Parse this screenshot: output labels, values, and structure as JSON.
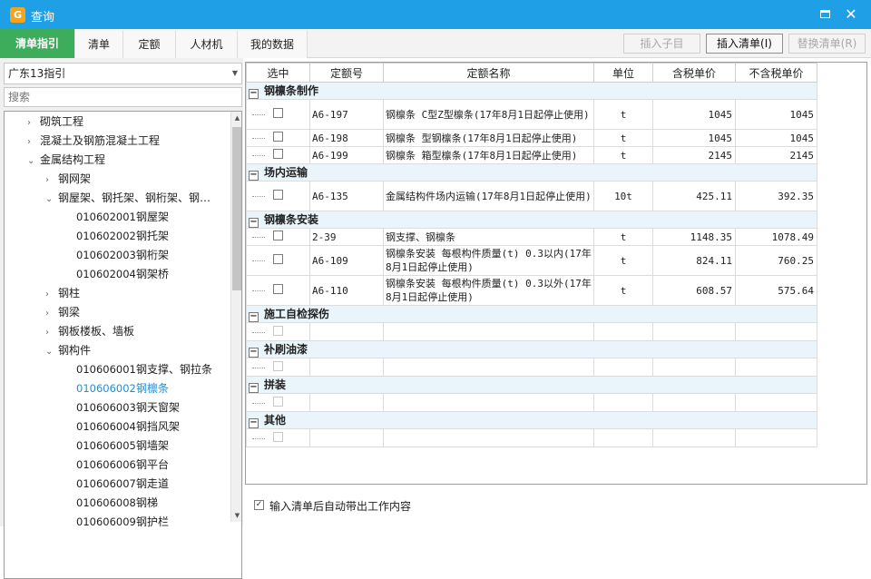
{
  "window": {
    "title": "查询",
    "app_icon": "app-logo-icon",
    "maximize_icon": "maximize-icon",
    "close_icon": "close-icon",
    "close_glyph": "✕"
  },
  "tabs": [
    {
      "label": "清单指引",
      "active": true
    },
    {
      "label": "清单",
      "active": false
    },
    {
      "label": "定额",
      "active": false
    },
    {
      "label": "人材机",
      "active": false
    },
    {
      "label": "我的数据",
      "active": false
    }
  ],
  "toolbar": {
    "insert_child": "插入子目",
    "insert_list": "插入清单(I)",
    "replace_list": "替换清单(R)"
  },
  "left": {
    "region": "广东13指引",
    "search_placeholder": "搜索",
    "tree": [
      {
        "label": "砌筑工程",
        "level": 1,
        "expander": "›"
      },
      {
        "label": "混凝土及钢筋混凝土工程",
        "level": 1,
        "expander": "›"
      },
      {
        "label": "金属结构工程",
        "level": 1,
        "expander": "⌄"
      },
      {
        "label": "钢网架",
        "level": 2,
        "expander": "›"
      },
      {
        "label": "钢屋架、钢托架、钢桁架、钢…",
        "level": 2,
        "expander": "⌄"
      },
      {
        "code": "010602001",
        "label": "钢屋架",
        "level": 3
      },
      {
        "code": "010602002",
        "label": "钢托架",
        "level": 3
      },
      {
        "code": "010602003",
        "label": "钢桁架",
        "level": 3
      },
      {
        "code": "010602004",
        "label": "钢架桥",
        "level": 3
      },
      {
        "label": "钢柱",
        "level": 2,
        "expander": "›"
      },
      {
        "label": "钢梁",
        "level": 2,
        "expander": "›"
      },
      {
        "label": "钢板楼板、墙板",
        "level": 2,
        "expander": "›"
      },
      {
        "label": "钢构件",
        "level": 2,
        "expander": "⌄"
      },
      {
        "code": "010606001",
        "label": "钢支撑、钢拉条",
        "level": 3
      },
      {
        "code": "010606002",
        "label": "钢檩条",
        "level": 3,
        "selected": true
      },
      {
        "code": "010606003",
        "label": "钢天窗架",
        "level": 3
      },
      {
        "code": "010606004",
        "label": "钢挡风架",
        "level": 3
      },
      {
        "code": "010606005",
        "label": "钢墙架",
        "level": 3
      },
      {
        "code": "010606006",
        "label": "钢平台",
        "level": 3
      },
      {
        "code": "010606007",
        "label": "钢走道",
        "level": 3
      },
      {
        "code": "010606008",
        "label": "钢梯",
        "level": 3
      },
      {
        "code": "010606009",
        "label": "钢护栏",
        "level": 3
      }
    ]
  },
  "table": {
    "headers": [
      "选中",
      "定额号",
      "定额名称",
      "单位",
      "含税单价",
      "不含税单价"
    ],
    "groups": [
      {
        "title": "钢檩条制作",
        "rows": [
          {
            "code": "A6-197",
            "name": "钢檩条 C型Z型檩条(17年8月1日起停止使用)",
            "unit": "t",
            "tax": "1045",
            "notax": "1045"
          },
          {
            "code": "A6-198",
            "name": "钢檩条 型钢檩条(17年8月1日起停止使用)",
            "unit": "t",
            "tax": "1045",
            "notax": "1045"
          },
          {
            "code": "A6-199",
            "name": "钢檩条 箱型檩条(17年8月1日起停止使用)",
            "unit": "t",
            "tax": "2145",
            "notax": "2145"
          }
        ]
      },
      {
        "title": "场内运输",
        "rows": [
          {
            "code": "A6-135",
            "name": "金属结构件场内运输(17年8月1日起停止使用)",
            "unit": "10t",
            "tax": "425.11",
            "notax": "392.35"
          }
        ]
      },
      {
        "title": "钢檩条安装",
        "rows": [
          {
            "code": "2-39",
            "name": "钢支撑、钢檩条",
            "unit": "t",
            "tax": "1148.35",
            "notax": "1078.49"
          },
          {
            "code": "A6-109",
            "name": "钢檩条安装 每根构件质量(t) 0.3以内(17年8月1日起停止使用)",
            "unit": "t",
            "tax": "824.11",
            "notax": "760.25"
          },
          {
            "code": "A6-110",
            "name": "钢檩条安装 每根构件质量(t) 0.3以外(17年8月1日起停止使用)",
            "unit": "t",
            "tax": "608.57",
            "notax": "575.64"
          }
        ]
      },
      {
        "title": "施工自检探伤",
        "rows": [
          {
            "code": "",
            "name": "",
            "unit": "",
            "tax": "",
            "notax": "",
            "empty": true
          }
        ]
      },
      {
        "title": "补刷油漆",
        "rows": [
          {
            "code": "",
            "name": "",
            "unit": "",
            "tax": "",
            "notax": "",
            "empty": true
          }
        ]
      },
      {
        "title": "拼装",
        "rows": [
          {
            "code": "",
            "name": "",
            "unit": "",
            "tax": "",
            "notax": "",
            "empty": true
          }
        ]
      },
      {
        "title": "其他",
        "rows": [
          {
            "code": "",
            "name": "",
            "unit": "",
            "tax": "",
            "notax": "",
            "empty": true
          }
        ]
      }
    ]
  },
  "footer": {
    "auto_fill_label": "输入清单后自动带出工作内容",
    "auto_fill_checked": true,
    "check_glyph": "✓"
  },
  "colors": {
    "titlebar": "#1fa0e6",
    "active_tab": "#3dad5c",
    "selected_tree": "#1f8ed6",
    "group_row": "#eaf5fb"
  }
}
